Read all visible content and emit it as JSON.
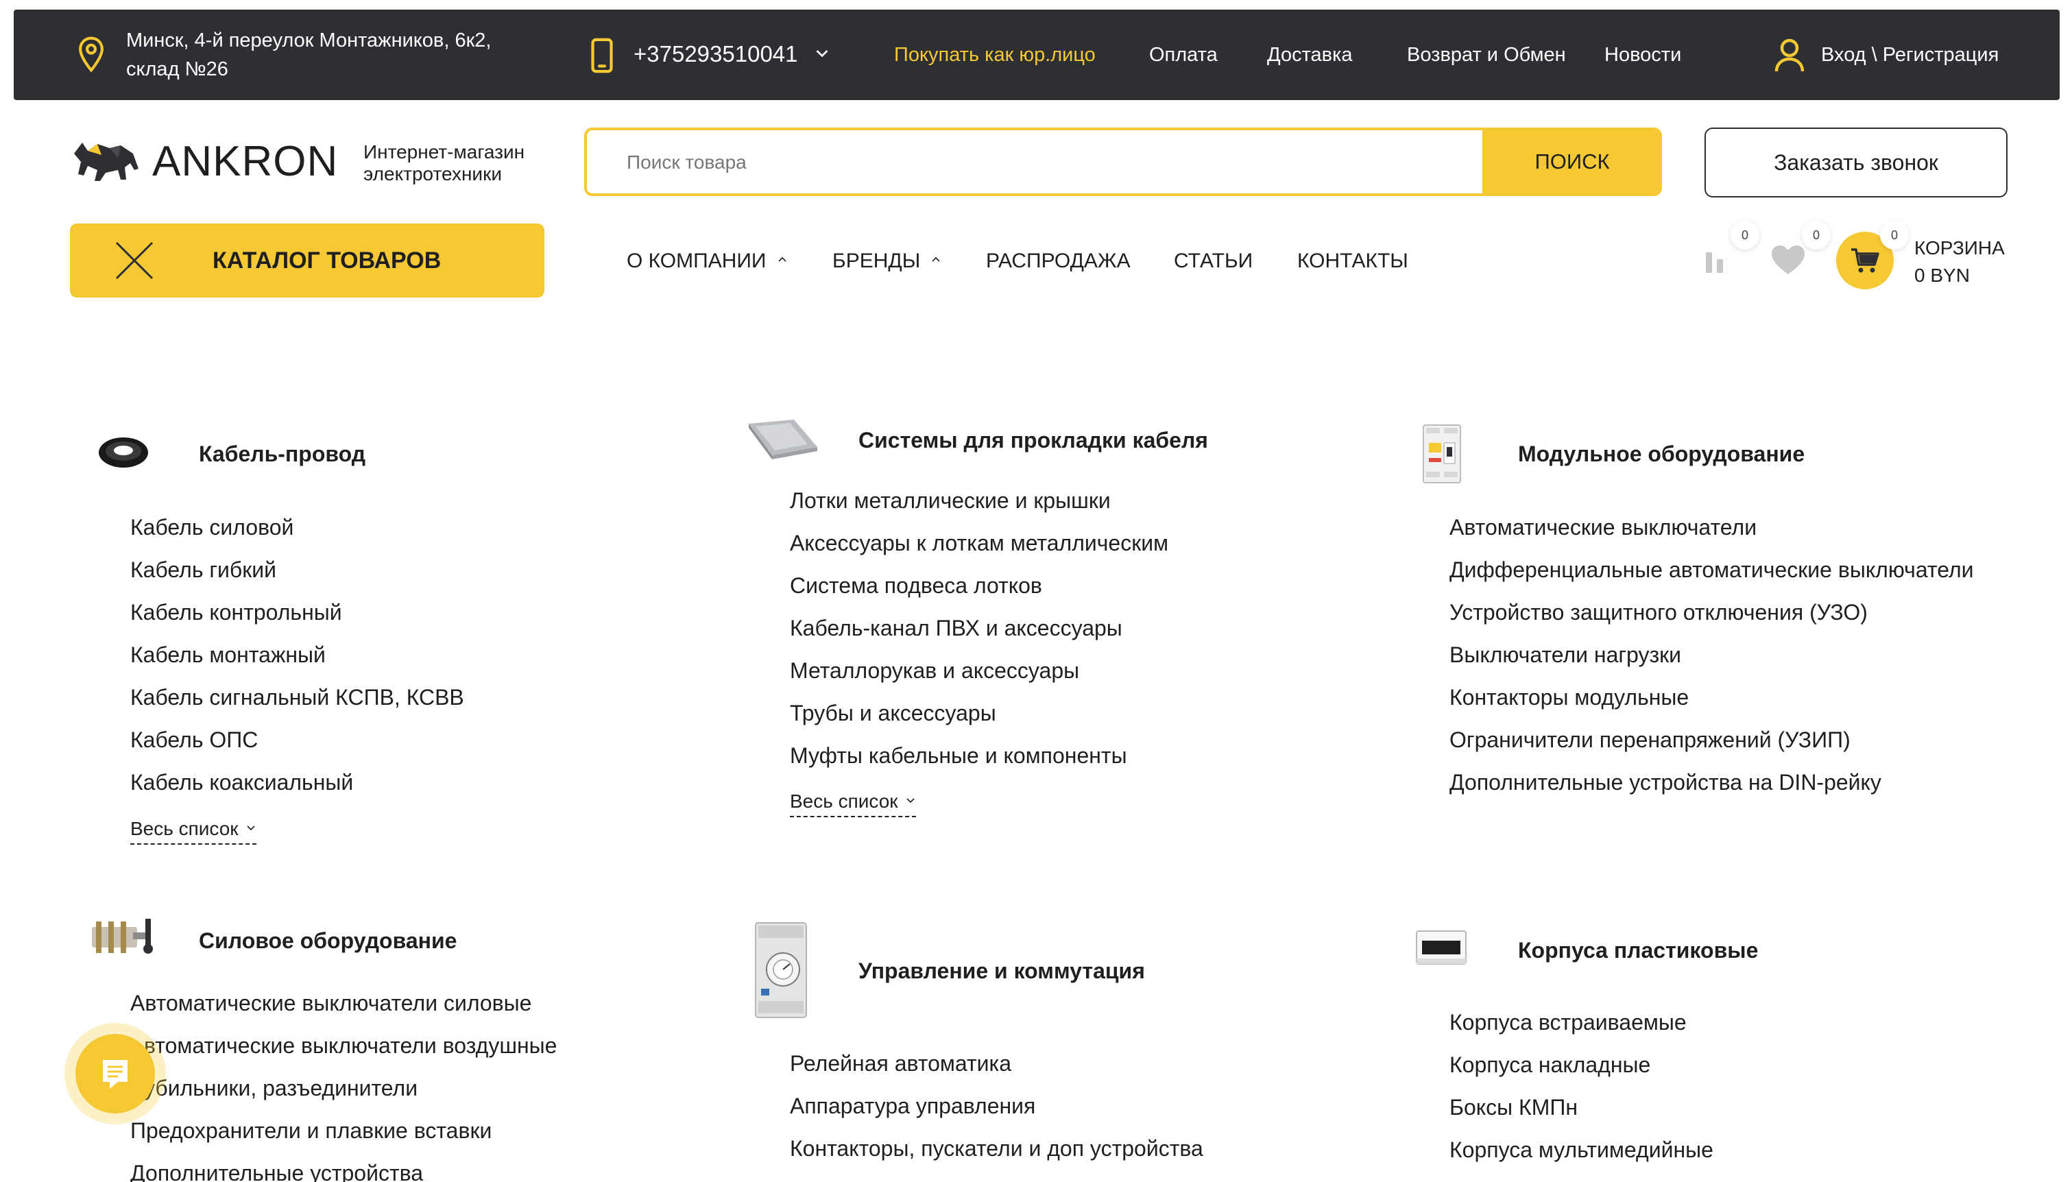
{
  "topbar": {
    "address_line1": "Минск, 4-й переулок Монтажников, 6к2,",
    "address_line2": "склад №26",
    "phone": "+375293510041",
    "links": [
      "Покупать как юр.лицо",
      "Оплата",
      "Доставка",
      "Возврат и Обмен",
      "Новости"
    ],
    "login": "Вход \\ Регистрация"
  },
  "header": {
    "logo": "ANKRON",
    "tagline_line1": "Интернет-магазин",
    "tagline_line2": "электротехники",
    "search_placeholder": "Поиск товара",
    "search_button": "ПОИСК",
    "callback_button": "Заказать звонок",
    "catalog_button": "КАТАЛОГ ТОВАРОВ"
  },
  "nav": {
    "items": [
      "О КОМПАНИИ",
      "БРЕНДЫ",
      "РАСПРОДАЖА",
      "СТАТЬИ",
      "КОНТАКТЫ"
    ]
  },
  "counters": {
    "compare": "0",
    "favorites": "0",
    "cart": "0",
    "cart_label": "КОРЗИНА",
    "cart_total": "0 BYN"
  },
  "catalog": {
    "more_label": "Весь список",
    "sections": [
      {
        "title": "Кабель-провод",
        "items": [
          "Кабель силовой",
          "Кабель гибкий",
          "Кабель контрольный",
          "Кабель монтажный",
          "Кабель сигнальный КСПВ, КСВВ",
          "Кабель ОПС",
          "Кабель коаксиальный"
        ]
      },
      {
        "title": "Системы для прокладки кабеля",
        "items": [
          "Лотки металлические и крышки",
          "Аксессуары к лоткам металлическим",
          "Система подвеса лотков",
          "Кабель-канал ПВХ и аксессуары",
          "Металлорукав и аксессуары",
          "Трубы и аксессуары",
          "Муфты кабельные и компоненты"
        ]
      },
      {
        "title": "Модульное оборудование",
        "items": [
          "Автоматические выключатели",
          "Дифференциальные автоматические выключатели",
          "Устройство защитного отключения (УЗО)",
          "Выключатели нагрузки",
          "Контакторы модульные",
          "Ограничители перенапряжений (УЗИП)",
          "Дополнительные устройства на DIN-рейку"
        ]
      },
      {
        "title": "Силовое оборудование",
        "items": [
          "Автоматические выключатели силовые",
          "втоматические выключатели воздушные",
          "убильники, разъединители",
          "Предохранители и плавкие вставки",
          "Дополнительные устройства"
        ]
      },
      {
        "title": "Управление и коммутация",
        "items": [
          "Релейная автоматика",
          "Аппаратура управления",
          "Контакторы, пускатели и доп устройства"
        ]
      },
      {
        "title": "Корпуса пластиковые",
        "items": [
          "Корпуса встраиваемые",
          "Корпуса накладные",
          "Боксы КМПн",
          "Корпуса мультимедийные"
        ]
      }
    ]
  },
  "colors": {
    "accent": "#f6c934",
    "topbar_bg": "#2e2f33",
    "text": "#1f1f1f"
  },
  "icons": [
    "location-pin-icon",
    "phone-icon",
    "chevron-down-icon",
    "user-icon",
    "bull-logo-icon",
    "close-icon",
    "chevron-up-icon",
    "compare-icon",
    "heart-icon",
    "cart-icon",
    "chat-icon"
  ]
}
